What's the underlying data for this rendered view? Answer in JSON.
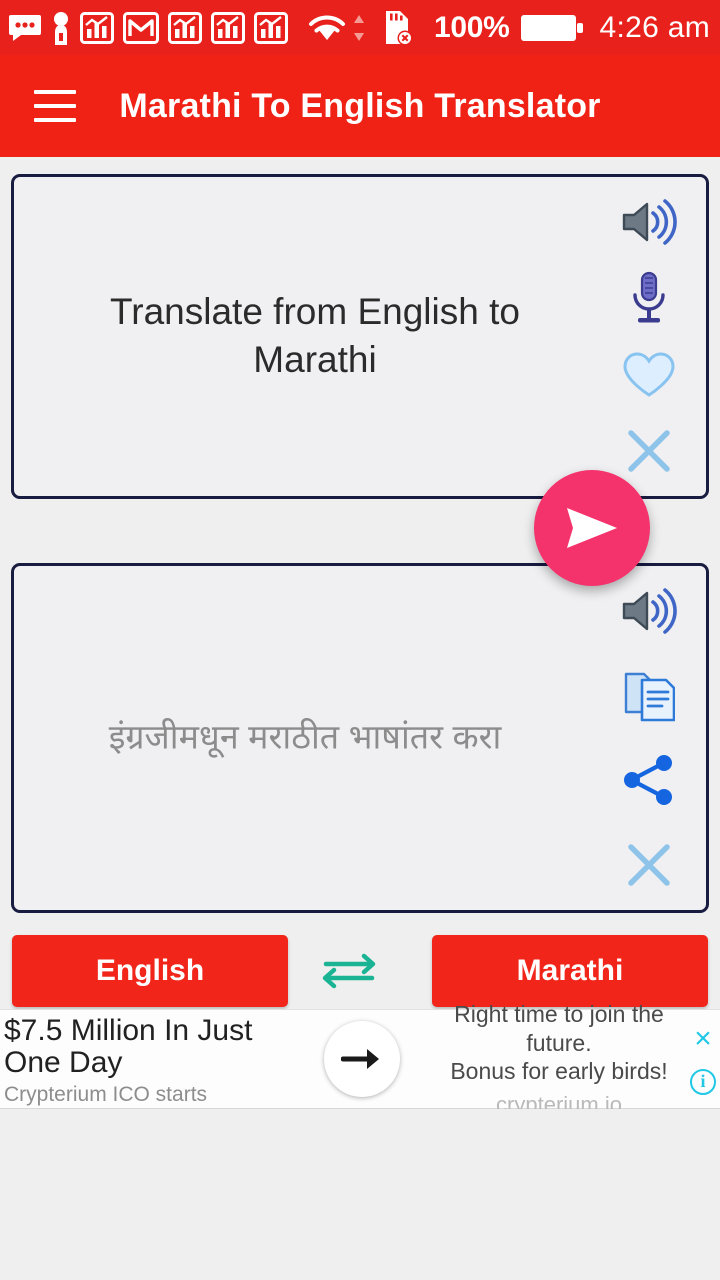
{
  "statusbar": {
    "icons": [
      {
        "name": "messages-icon",
        "glyph": "chat-dots"
      },
      {
        "name": "keyguard-icon",
        "glyph": "person-key"
      },
      {
        "name": "chart-app-icon-1",
        "glyph": "bar-chart"
      },
      {
        "name": "gmail-icon",
        "glyph": "gmail-m"
      },
      {
        "name": "chart-app-icon-2",
        "glyph": "bar-chart"
      },
      {
        "name": "chart-app-icon-3",
        "glyph": "bar-chart"
      },
      {
        "name": "chart-app-icon-4",
        "glyph": "bar-chart"
      }
    ],
    "wifi_label": "wifi-icon",
    "sdcard_label": "sdcard-error-icon",
    "battery_percent": "100%",
    "battery_label": "battery-full-icon",
    "time": "4:26 am"
  },
  "appbar": {
    "menu_label": "menu-icon",
    "title": "Marathi To English Translator",
    "background": "#f02216"
  },
  "input_card": {
    "text": "Translate from English to Marathi",
    "icons": [
      {
        "name": "speaker-icon",
        "label": "Speak"
      },
      {
        "name": "microphone-icon",
        "label": "Voice input"
      },
      {
        "name": "heart-icon",
        "label": "Favorite"
      },
      {
        "name": "close-icon",
        "label": "Clear"
      }
    ]
  },
  "fab": {
    "name": "translate-send-button",
    "label": "Translate",
    "color": "#f4336d",
    "icon": "send-icon"
  },
  "output_card": {
    "text": "इंग्रजीमधून मराठीत भाषांतर करा",
    "icons": [
      {
        "name": "speaker-icon",
        "label": "Speak"
      },
      {
        "name": "copy-icon",
        "label": "Copy"
      },
      {
        "name": "share-icon",
        "label": "Share"
      },
      {
        "name": "close-icon",
        "label": "Clear"
      }
    ]
  },
  "language_bar": {
    "source_language": "English",
    "target_language": "Marathi",
    "swap_label": "swap-languages-icon",
    "button_color": "#f12519",
    "swap_color": "#1ab394"
  },
  "ad": {
    "headline": "$7.5 Million In Just One Day",
    "subline": "Crypterium ICO starts",
    "arrow_label": "ad-arrow-icon",
    "body_line_1": "Right time to join the future.",
    "body_line_2": "Bonus for early birds!",
    "url": "crypterium.io",
    "close_label": "×",
    "info_label": "i",
    "control_color": "#21c8e6"
  }
}
